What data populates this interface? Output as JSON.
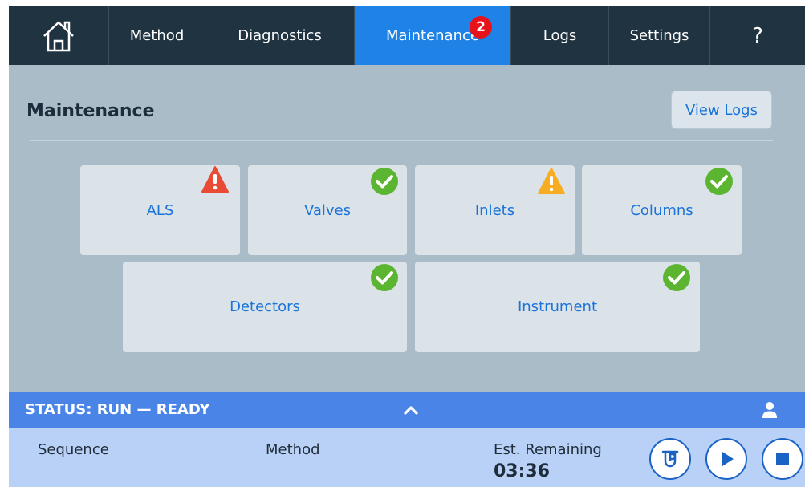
{
  "nav": {
    "home_icon": "home-icon",
    "items": [
      {
        "label": "Method"
      },
      {
        "label": "Diagnostics"
      },
      {
        "label": "Maintenance",
        "badge": "2",
        "active": true
      },
      {
        "label": "Logs"
      },
      {
        "label": "Settings"
      }
    ],
    "help_label": "?"
  },
  "page": {
    "title": "Maintenance",
    "view_logs_label": "View Logs"
  },
  "tiles": [
    {
      "label": "ALS",
      "status": "error"
    },
    {
      "label": "Valves",
      "status": "ok"
    },
    {
      "label": "Inlets",
      "status": "warning"
    },
    {
      "label": "Columns",
      "status": "ok"
    },
    {
      "label": "Detectors",
      "status": "ok"
    },
    {
      "label": "Instrument",
      "status": "ok"
    }
  ],
  "status_bar": {
    "text": "STATUS: RUN — READY",
    "expand_icon": "chevron-up-icon",
    "user_icon": "user-icon"
  },
  "status_panel": {
    "sequence_label": "Sequence",
    "method_label": "Method",
    "remaining_label": "Est. Remaining",
    "remaining_value": "03:36"
  },
  "colors": {
    "nav_bg": "#1f3341",
    "active_tab": "#1e82e6",
    "badge": "#e8121a",
    "ok": "#5cb531",
    "warning": "#f7ad22",
    "error": "#e94b35",
    "status_bar": "#4a84e6",
    "accent_text": "#1a73d9"
  }
}
